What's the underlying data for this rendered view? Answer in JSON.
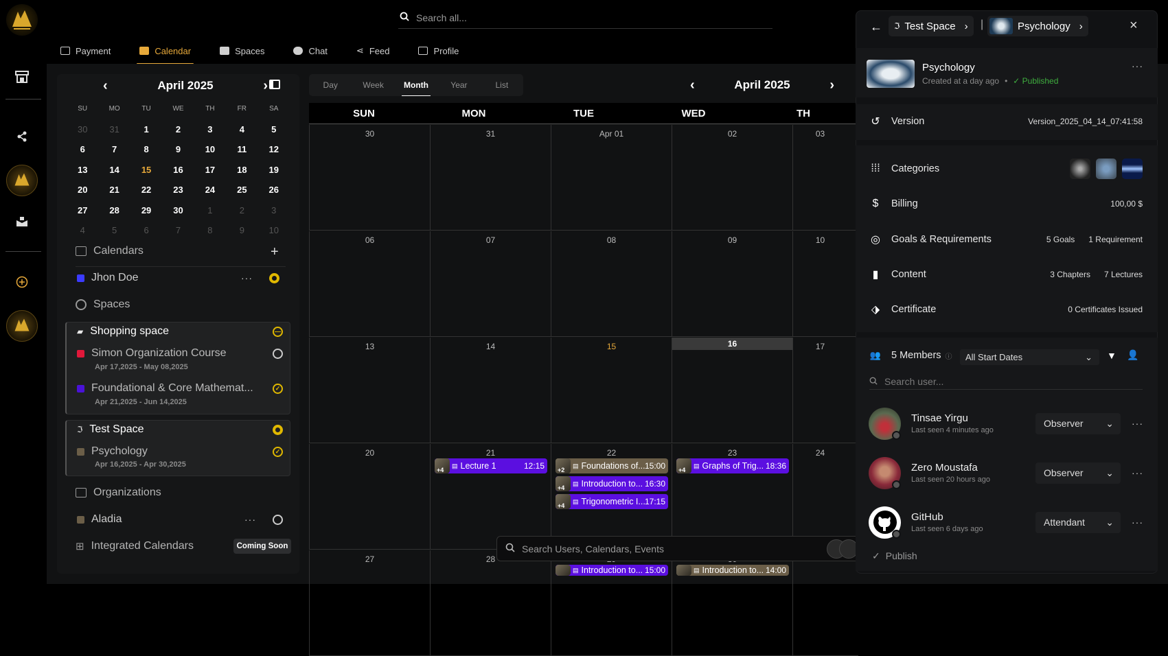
{
  "header": {
    "search_placeholder": "Search all..."
  },
  "nav": [
    {
      "label": "Payment",
      "icon": "card-icon"
    },
    {
      "label": "Calendar",
      "icon": "calendar-icon",
      "active": true
    },
    {
      "label": "Spaces",
      "icon": "spaces-icon"
    },
    {
      "label": "Chat",
      "icon": "chat-icon"
    },
    {
      "label": "Feed",
      "icon": "share-icon"
    },
    {
      "label": "Profile",
      "icon": "profile-icon"
    }
  ],
  "mini_calendar": {
    "title": "April 2025",
    "weekdays": [
      "SU",
      "MO",
      "TU",
      "WE",
      "TH",
      "FR",
      "SA"
    ],
    "days": [
      "30",
      "31",
      "1",
      "2",
      "3",
      "4",
      "5",
      "6",
      "7",
      "8",
      "9",
      "10",
      "11",
      "12",
      "13",
      "14",
      "15",
      "16",
      "17",
      "18",
      "19",
      "20",
      "21",
      "22",
      "23",
      "24",
      "25",
      "26",
      "27",
      "28",
      "29",
      "30",
      "1",
      "2",
      "3",
      "4",
      "5",
      "6",
      "7",
      "8",
      "9",
      "10"
    ],
    "today": "15"
  },
  "sidebar": {
    "calendars_label": "Calendars",
    "calendar_item": "Jhon Doe",
    "spaces_label": "Spaces",
    "shopping_space": "Shopping space",
    "course1_title": "Simon Organization Course",
    "course1_date": "Apr 17,2025 - May 08,2025",
    "course2_title": "Foundational & Core Mathemat...",
    "course2_date": "Apr 21,2025 - Jun 14,2025",
    "test_space": "Test Space",
    "course3_title": "Psychology",
    "course3_date": "Apr 16,2025 - Apr 30,2025",
    "organizations_label": "Organizations",
    "org_item": "Aladia",
    "integrated_label": "Integrated Calendars",
    "coming_soon": "Coming Soon"
  },
  "views": [
    "Day",
    "Week",
    "Month",
    "Year",
    "List"
  ],
  "active_view": "Month",
  "main_calendar": {
    "title": "April 2025",
    "headers": [
      "SUN",
      "MON",
      "TUE",
      "WED",
      "TH"
    ],
    "weeks": [
      [
        "30",
        "31",
        "Apr 01",
        "02",
        "03"
      ],
      [
        "06",
        "07",
        "08",
        "09",
        "10"
      ],
      [
        "13",
        "14",
        "15",
        "16",
        "17"
      ],
      [
        "20",
        "21",
        "22",
        "23",
        "24"
      ],
      [
        "27",
        "28",
        "29",
        "30",
        "01"
      ]
    ],
    "events": {
      "lecture1": {
        "title": "Lecture 1",
        "time": "12:15",
        "badge": "+4"
      },
      "foundations": {
        "title": "Foundations of...",
        "time": "15:00",
        "badge": "+2"
      },
      "intro1": {
        "title": "Introduction to...",
        "time": "16:30",
        "badge": "+4"
      },
      "trig": {
        "title": "Trigonometric I...",
        "time": "17:15",
        "badge": "+4"
      },
      "graphs": {
        "title": "Graphs of Trig...",
        "time": "18:36",
        "badge": "+4"
      },
      "intro2": {
        "title": "Introduction to...",
        "time": "15:00"
      },
      "intro3": {
        "title": "Introduction to...",
        "time": "14:00"
      }
    }
  },
  "bottom_search": {
    "placeholder": "Search Users, Calendars, Events"
  },
  "panel": {
    "breadcrumb_space": "Test Space",
    "breadcrumb_course": "Psychology",
    "course_title": "Psychology",
    "created": "Created at a day ago",
    "status": "Published",
    "version_label": "Version",
    "version_value": "Version_2025_04_14_07:41:58",
    "categories_label": "Categories",
    "billing_label": "Billing",
    "billing_value": "100,00 $",
    "goals_label": "Goals & Requirements",
    "goals_value": "5 Goals",
    "requirements_value": "1 Requirement",
    "content_label": "Content",
    "chapters_value": "3 Chapters",
    "lectures_value": "7 Lectures",
    "certificate_label": "Certificate",
    "certificate_value": "0 Certificates Issued",
    "members_label": "5 Members",
    "start_dates": "All Start Dates",
    "search_user_placeholder": "Search user...",
    "members": [
      {
        "name": "Tinsae Yirgu",
        "seen": "Last seen 4 minutes ago",
        "role": "Observer"
      },
      {
        "name": "Zero Moustafa",
        "seen": "Last seen 20 hours ago",
        "role": "Observer"
      },
      {
        "name": "GitHub",
        "seen": "Last seen 6 days ago",
        "role": "Attendant"
      }
    ],
    "publish_label": "Publish"
  },
  "colors": {
    "accent": "#e7a93a",
    "event_purple": "#5b0fe0",
    "check_yellow": "#e0b800",
    "published_green": "#3fae3f"
  }
}
